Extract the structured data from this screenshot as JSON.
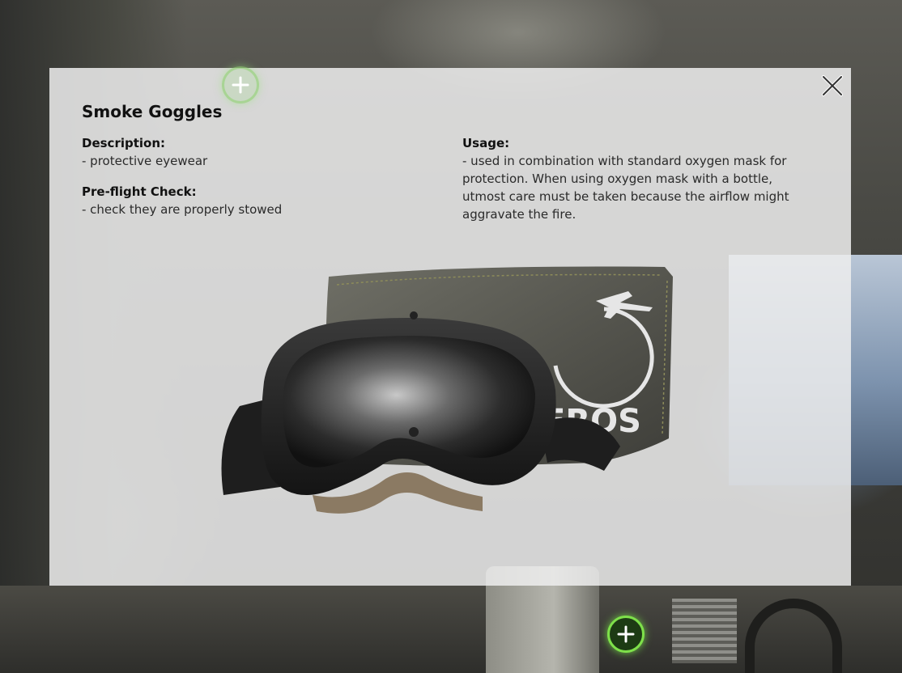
{
  "hotspots": [
    {
      "name": "hotspot-marker-faded",
      "icon": "plus-icon",
      "state": "inactive"
    },
    {
      "name": "hotspot-marker-active",
      "icon": "plus-icon",
      "state": "active"
    }
  ],
  "modal": {
    "title": "Smoke Goggles",
    "close_icon": "close-icon",
    "description": {
      "label": "Description:",
      "text": "- protective eyewear"
    },
    "preflight": {
      "label": "Pre-flight Check:",
      "text": "- check they are properly stowed"
    },
    "usage": {
      "label": "Usage:",
      "text": "- used in combination with standard oxygen mask for protection. When using oxygen mask with a bottle, utmost care must be taken because the airflow might aggravate the fire."
    },
    "image": {
      "pouch_logo_text": "EROS"
    }
  },
  "colors": {
    "hotspot_green": "#7ee04a",
    "modal_background": "#eeeeee",
    "text": "#111111"
  }
}
